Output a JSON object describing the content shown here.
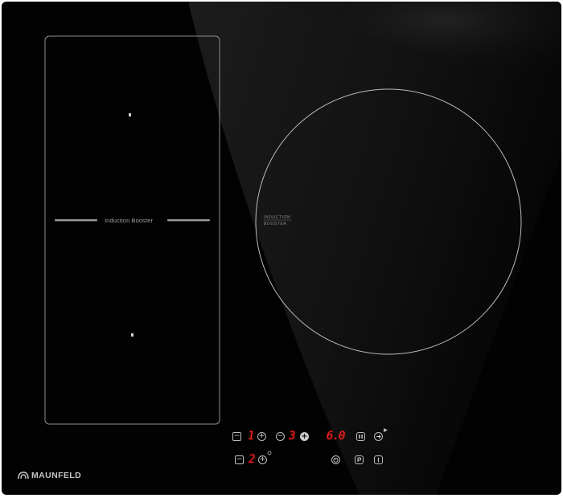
{
  "brand": {
    "name": "MAUNFELD"
  },
  "flex_zone": {
    "label": "Induction Booster"
  },
  "round_zone": {
    "label_line1": "INDUCTION",
    "label_line2": "BOOSTER"
  },
  "controls": {
    "zone1_level": "1",
    "zone2_level": "3",
    "timer_display": "6.0",
    "zone3_level": "2",
    "minus_symbol": "−",
    "plus_symbol": "+"
  },
  "colors": {
    "glass": "#020202",
    "display_red": "#ff1f1f",
    "line_grey": "#bdbdbd"
  }
}
